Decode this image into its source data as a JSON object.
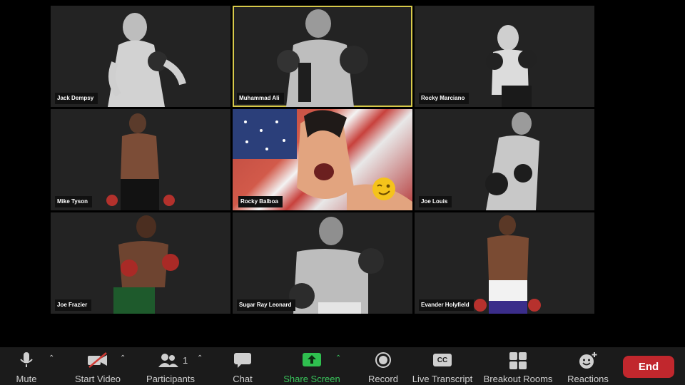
{
  "participants_grid": [
    {
      "name": "Jack Dempsy",
      "active": false
    },
    {
      "name": "Muhammad Ali",
      "active": true
    },
    {
      "name": "Rocky Marciano",
      "active": false
    },
    {
      "name": "Mike Tyson",
      "active": false
    },
    {
      "name": "Rocky Balboa",
      "active": false,
      "reaction": "winking-face-emoji"
    },
    {
      "name": "Joe Louis",
      "active": false
    },
    {
      "name": "Joe Frazier",
      "active": false
    },
    {
      "name": "Sugar Ray Leonard",
      "active": false
    },
    {
      "name": "Evander Holyfield",
      "active": false
    }
  ],
  "toolbar": {
    "mute_label": "Mute",
    "start_video_label": "Start Video",
    "participants_label": "Participants",
    "participants_count": "1",
    "chat_label": "Chat",
    "share_screen_label": "Share Screen",
    "record_label": "Record",
    "live_transcript_label": "Live Transcript",
    "live_transcript_icon_text": "CC",
    "breakout_rooms_label": "Breakout Rooms",
    "reactions_label": "Reactions",
    "end_label": "End"
  },
  "colors": {
    "active_speaker_border": "#d7c94a",
    "share_green": "#39c35b",
    "end_red": "#c1272d",
    "toolbar_bg": "#1b1b1b"
  }
}
